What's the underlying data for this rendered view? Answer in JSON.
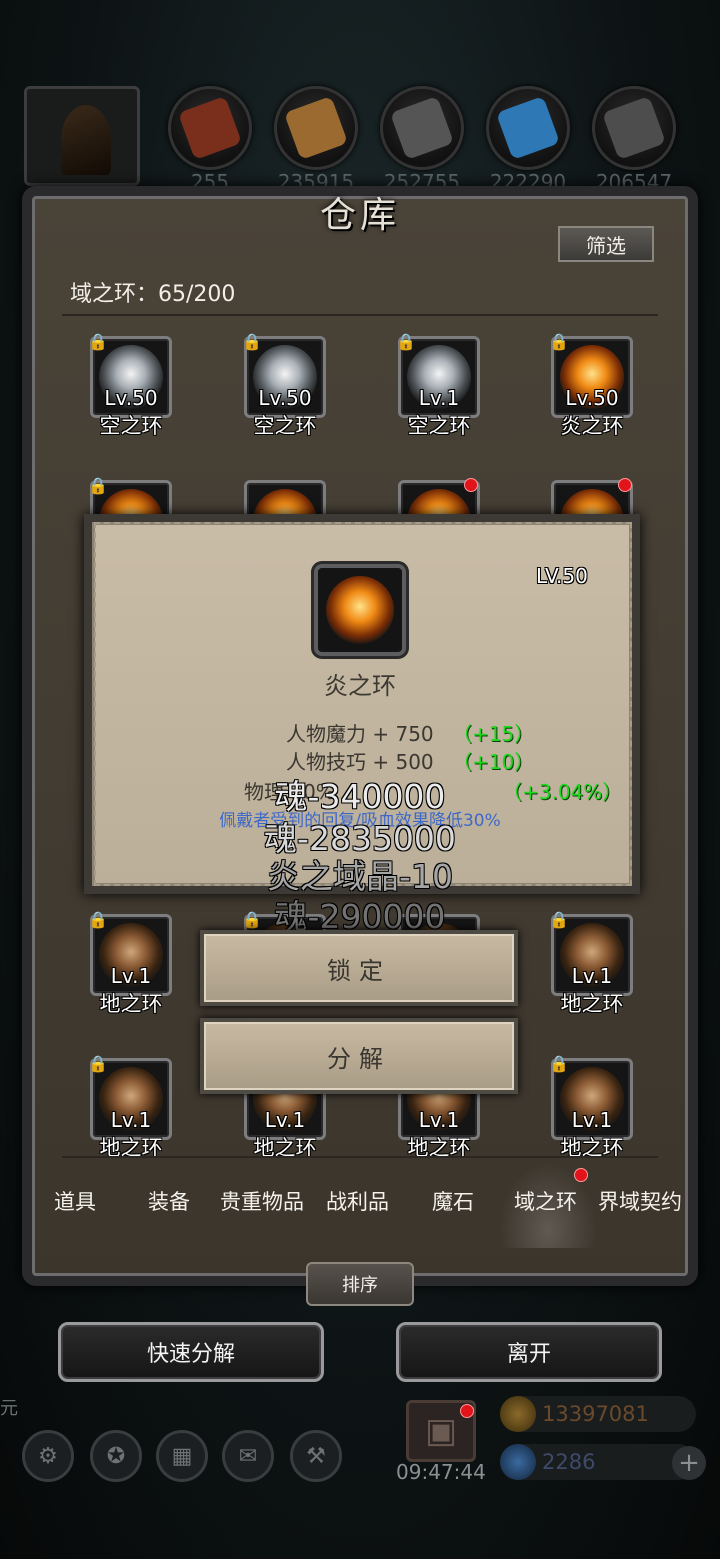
{
  "header": {
    "character_icon": "hooded-character-icon",
    "resources": [
      {
        "icon": "leather-icon",
        "color": "#b04a2a",
        "value": "255"
      },
      {
        "icon": "wood-icon",
        "color": "#b9813f",
        "value": "235915"
      },
      {
        "icon": "iron-icon",
        "color": "#6a6a6a",
        "value": "252755"
      },
      {
        "icon": "crystal-icon",
        "color": "#3d8ec9",
        "value": "222290"
      },
      {
        "icon": "stone-icon",
        "color": "#7a7a7a",
        "value": "206547"
      }
    ]
  },
  "panel": {
    "title": "仓库",
    "filter_label": "筛选",
    "count_label": "域之环：65/200",
    "sort_label": "排序"
  },
  "items": [
    {
      "level": "Lv.50",
      "name": "空之环",
      "type": "air"
    },
    {
      "level": "Lv.50",
      "name": "空之环",
      "type": "air"
    },
    {
      "level": "Lv.1",
      "name": "空之环",
      "type": "air"
    },
    {
      "level": "Lv.50",
      "name": "炎之环",
      "type": "fire"
    },
    {
      "level": "Lv.1",
      "name": "地之环",
      "type": "earth"
    },
    {
      "level": "Lv.1",
      "name": "地之环",
      "type": "earth"
    },
    {
      "level": "Lv.1",
      "name": "地之环",
      "type": "earth"
    },
    {
      "level": "Lv.1",
      "name": "地之环",
      "type": "earth"
    },
    {
      "level": "Lv.1",
      "name": "地之环",
      "type": "earth"
    },
    {
      "level": "Lv.1",
      "name": "地之环",
      "type": "earth"
    }
  ],
  "tabs": [
    {
      "label": "道具"
    },
    {
      "label": "装备"
    },
    {
      "label": "贵重物品"
    },
    {
      "label": "战利品"
    },
    {
      "label": "魔石"
    },
    {
      "label": "域之环"
    },
    {
      "label": "界域契约"
    }
  ],
  "actions": {
    "quick_decompose": "快速分解",
    "leave": "离开"
  },
  "bottom_bar": {
    "yuan_label": "元",
    "icons": [
      "gear-icon",
      "star-icon",
      "menu-icon",
      "mail-icon",
      "handshake-icon"
    ],
    "clock": "09:47:44",
    "gold": "13397081",
    "gems": "2286",
    "plus": "+"
  },
  "popup": {
    "level": "LV.50",
    "name": "炎之环",
    "stats": [
      {
        "text": "人物魔力 + 750",
        "bonus": "（+15）"
      },
      {
        "text": "人物技巧 + 500",
        "bonus": "（+10）"
      },
      {
        "text": "物理...0%",
        "bonus": "（+3.04%）"
      }
    ],
    "description": "佩戴者受到的回复/吸血效果降低30%",
    "floating": [
      "魂-340000",
      "魂-2835000",
      "炎之域晶-10",
      "魂-290000"
    ],
    "lock_label": "锁定",
    "decompose_label": "分解"
  }
}
